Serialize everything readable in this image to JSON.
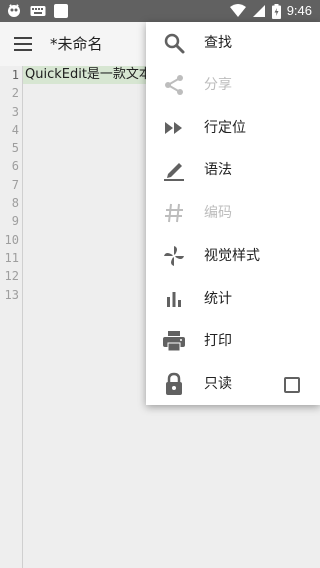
{
  "status_bar": {
    "time": "9:46",
    "icons": [
      "app-notification-icon",
      "keyboard-icon",
      "square-icon",
      "wifi-icon",
      "signal-icon",
      "battery-icon"
    ]
  },
  "app_bar": {
    "title": "*未命名",
    "menu_icon": "hamburger-icon"
  },
  "editor": {
    "line_numbers": [
      "1",
      "2",
      "3",
      "4",
      "5",
      "6",
      "7",
      "8",
      "9",
      "10",
      "11",
      "12",
      "13"
    ],
    "lines": [
      "QuickEdit是一款文本"
    ],
    "highlight_color": "#d7e6d2"
  },
  "overflow_menu": {
    "items": [
      {
        "label": "查找",
        "icon": "search-icon",
        "enabled": true
      },
      {
        "label": "分享",
        "icon": "share-icon",
        "enabled": false
      },
      {
        "label": "行定位",
        "icon": "fast-forward-icon",
        "enabled": true
      },
      {
        "label": "语法",
        "icon": "pen-icon",
        "enabled": true
      },
      {
        "label": "编码",
        "icon": "hash-icon",
        "enabled": false
      },
      {
        "label": "视觉样式",
        "icon": "pinwheel-icon",
        "enabled": true
      },
      {
        "label": "统计",
        "icon": "bar-chart-icon",
        "enabled": true
      },
      {
        "label": "打印",
        "icon": "printer-icon",
        "enabled": true
      },
      {
        "label": "只读",
        "icon": "lock-icon",
        "enabled": true,
        "checked": false
      }
    ]
  },
  "colors": {
    "status_bar": "#616161",
    "app_bar": "#f5f5f5",
    "editor_bg": "#eeeeee",
    "menu_bg": "#ffffff",
    "icon_active": "#616161",
    "icon_disabled": "#bdbdbd"
  }
}
